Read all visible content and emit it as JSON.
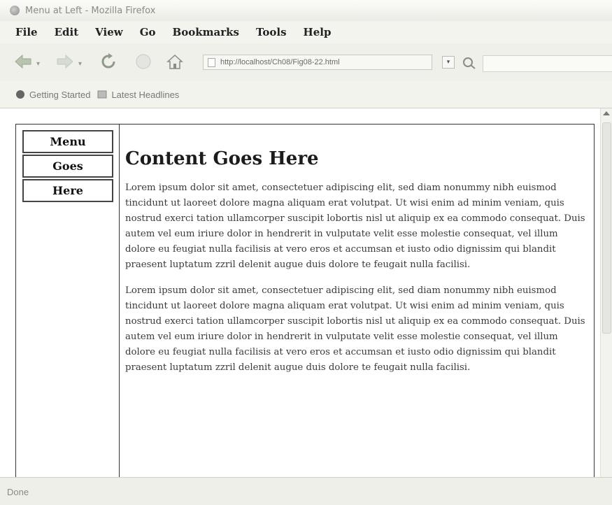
{
  "window": {
    "title": "Menu at Left - Mozilla Firefox"
  },
  "menubar": {
    "items": [
      "File",
      "Edit",
      "View",
      "Go",
      "Bookmarks",
      "Tools",
      "Help"
    ]
  },
  "navbar": {
    "url": "http://localhost/Ch08/Fig08-22.html"
  },
  "bookmarks": {
    "items": [
      "Getting Started",
      "Latest Headlines"
    ]
  },
  "page": {
    "menu": [
      "Menu",
      "Goes",
      "Here"
    ],
    "heading": "Content Goes Here",
    "paragraphs": [
      "Lorem ipsum dolor sit amet, consectetuer adipiscing elit, sed diam nonummy nibh euismod tincidunt ut laoreet dolore magna aliquam erat volutpat. Ut wisi enim ad minim veniam, quis nostrud exerci tation ullamcorper suscipit lobortis nisl ut aliquip ex ea commodo consequat. Duis autem vel eum iriure dolor in hendrerit in vulputate velit esse molestie consequat, vel illum dolore eu feugiat nulla facilisis at vero eros et accumsan et iusto odio dignissim qui blandit praesent luptatum zzril delenit augue duis dolore te feugait nulla facilisi.",
      "Lorem ipsum dolor sit amet, consectetuer adipiscing elit, sed diam nonummy nibh euismod tincidunt ut laoreet dolore magna aliquam erat volutpat. Ut wisi enim ad minim veniam, quis nostrud exerci tation ullamcorper suscipit lobortis nisl ut aliquip ex ea commodo consequat. Duis autem vel eum iriure dolor in hendrerit in vulputate velit esse molestie consequat, vel illum dolore eu feugiat nulla facilisis at vero eros et accumsan et iusto odio dignissim qui blandit praesent luptatum zzril delenit augue duis dolore te feugait nulla facilisi."
    ]
  },
  "statusbar": {
    "text": "Done"
  },
  "icons": {
    "app": "firefox-icon",
    "back": "back-arrow-icon",
    "forward": "forward-arrow-icon",
    "reload": "reload-icon",
    "stop": "stop-icon",
    "home": "home-icon",
    "search": "search-icon",
    "getting_started": "bookmark-icon",
    "latest_headlines": "rss-icon"
  }
}
